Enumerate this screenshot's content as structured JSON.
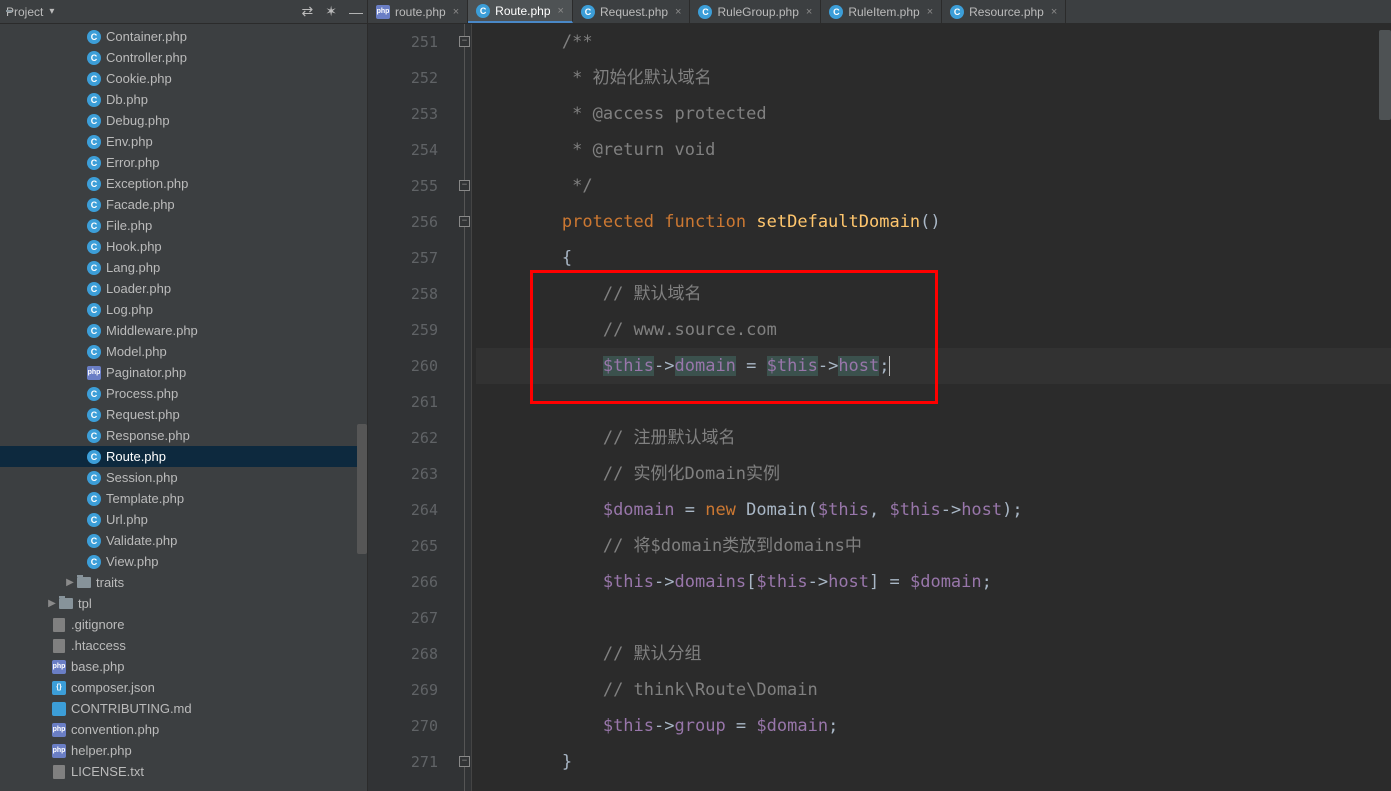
{
  "sidebar": {
    "title": "Project",
    "files": [
      {
        "label": "Container.php",
        "indent": 86,
        "icon": "php-c"
      },
      {
        "label": "Controller.php",
        "indent": 86,
        "icon": "php-c"
      },
      {
        "label": "Cookie.php",
        "indent": 86,
        "icon": "php-c"
      },
      {
        "label": "Db.php",
        "indent": 86,
        "icon": "php-c"
      },
      {
        "label": "Debug.php",
        "indent": 86,
        "icon": "php-c"
      },
      {
        "label": "Env.php",
        "indent": 86,
        "icon": "php-c"
      },
      {
        "label": "Error.php",
        "indent": 86,
        "icon": "php-c"
      },
      {
        "label": "Exception.php",
        "indent": 86,
        "icon": "php-c"
      },
      {
        "label": "Facade.php",
        "indent": 86,
        "icon": "php-c"
      },
      {
        "label": "File.php",
        "indent": 86,
        "icon": "php-c"
      },
      {
        "label": "Hook.php",
        "indent": 86,
        "icon": "php-c"
      },
      {
        "label": "Lang.php",
        "indent": 86,
        "icon": "php-c"
      },
      {
        "label": "Loader.php",
        "indent": 86,
        "icon": "php-c"
      },
      {
        "label": "Log.php",
        "indent": 86,
        "icon": "php-c"
      },
      {
        "label": "Middleware.php",
        "indent": 86,
        "icon": "php-c"
      },
      {
        "label": "Model.php",
        "indent": 86,
        "icon": "php-c"
      },
      {
        "label": "Paginator.php",
        "indent": 86,
        "icon": "php-script"
      },
      {
        "label": "Process.php",
        "indent": 86,
        "icon": "php-c"
      },
      {
        "label": "Request.php",
        "indent": 86,
        "icon": "php-c"
      },
      {
        "label": "Response.php",
        "indent": 86,
        "icon": "php-c"
      },
      {
        "label": "Route.php",
        "indent": 86,
        "icon": "php-c",
        "selected": true
      },
      {
        "label": "Session.php",
        "indent": 86,
        "icon": "php-c"
      },
      {
        "label": "Template.php",
        "indent": 86,
        "icon": "php-c"
      },
      {
        "label": "Url.php",
        "indent": 86,
        "icon": "php-c"
      },
      {
        "label": "Validate.php",
        "indent": 86,
        "icon": "php-c"
      },
      {
        "label": "View.php",
        "indent": 86,
        "icon": "php-c"
      },
      {
        "label": "traits",
        "indent": 64,
        "icon": "folder",
        "arrow": "▶"
      },
      {
        "label": "tpl",
        "indent": 46,
        "icon": "folder",
        "arrow": "▶"
      },
      {
        "label": ".gitignore",
        "indent": 51,
        "icon": "txt"
      },
      {
        "label": ".htaccess",
        "indent": 51,
        "icon": "txt"
      },
      {
        "label": "base.php",
        "indent": 51,
        "icon": "php-script"
      },
      {
        "label": "composer.json",
        "indent": 51,
        "icon": "json"
      },
      {
        "label": "CONTRIBUTING.md",
        "indent": 51,
        "icon": "md"
      },
      {
        "label": "convention.php",
        "indent": 51,
        "icon": "php-script"
      },
      {
        "label": "helper.php",
        "indent": 51,
        "icon": "php-script"
      },
      {
        "label": "LICENSE.txt",
        "indent": 51,
        "icon": "txt"
      }
    ]
  },
  "tabs": [
    {
      "label": "route.php",
      "icon": "php-script",
      "active": false
    },
    {
      "label": "Route.php",
      "icon": "php-c",
      "active": true
    },
    {
      "label": "Request.php",
      "icon": "php-c",
      "active": false
    },
    {
      "label": "RuleGroup.php",
      "icon": "php-c",
      "active": false
    },
    {
      "label": "RuleItem.php",
      "icon": "php-c",
      "active": false
    },
    {
      "label": "Resource.php",
      "icon": "php-c",
      "active": false
    }
  ],
  "editor": {
    "startLine": 251,
    "lines": [
      {
        "n": 251,
        "type": "comment",
        "text": "        /**"
      },
      {
        "n": 252,
        "type": "comment",
        "text": "         * 初始化默认域名"
      },
      {
        "n": 253,
        "type": "comment",
        "text": "         * @access protected"
      },
      {
        "n": 254,
        "type": "comment",
        "text": "         * @return void"
      },
      {
        "n": 255,
        "type": "comment",
        "text": "         */"
      },
      {
        "n": 256,
        "type": "sig"
      },
      {
        "n": 257,
        "type": "plain",
        "text": "        {"
      },
      {
        "n": 258,
        "type": "lcomment",
        "text": "            // 默认域名"
      },
      {
        "n": 259,
        "type": "lcomment",
        "text": "            // www.source.com"
      },
      {
        "n": 260,
        "type": "l260",
        "current": true
      },
      {
        "n": 261,
        "type": "plain",
        "text": ""
      },
      {
        "n": 262,
        "type": "lcomment",
        "text": "            // 注册默认域名"
      },
      {
        "n": 263,
        "type": "lcomment",
        "text": "            // 实例化Domain实例"
      },
      {
        "n": 264,
        "type": "l264"
      },
      {
        "n": 265,
        "type": "lcomment",
        "text": "            // 将$domain类放到domains中"
      },
      {
        "n": 266,
        "type": "l266"
      },
      {
        "n": 267,
        "type": "plain",
        "text": ""
      },
      {
        "n": 268,
        "type": "lcomment",
        "text": "            // 默认分组"
      },
      {
        "n": 269,
        "type": "lcomment",
        "text": "            // think\\Route\\Domain"
      },
      {
        "n": 270,
        "type": "l270"
      },
      {
        "n": 271,
        "type": "plain",
        "text": "        }"
      }
    ],
    "tokens": {
      "protected": "protected",
      "function": "function",
      "funcName": "setDefaultDomain",
      "this": "$this",
      "domain": "domain",
      "host": "host",
      "new": "new",
      "DomainClass": "Domain",
      "domainsProp": "domains",
      "groupProp": "group",
      "domainVar": "$domain"
    },
    "redBox": {
      "topLine": 258,
      "bottomLine": 261
    },
    "foldMarks": [
      251,
      255,
      256,
      271
    ]
  }
}
